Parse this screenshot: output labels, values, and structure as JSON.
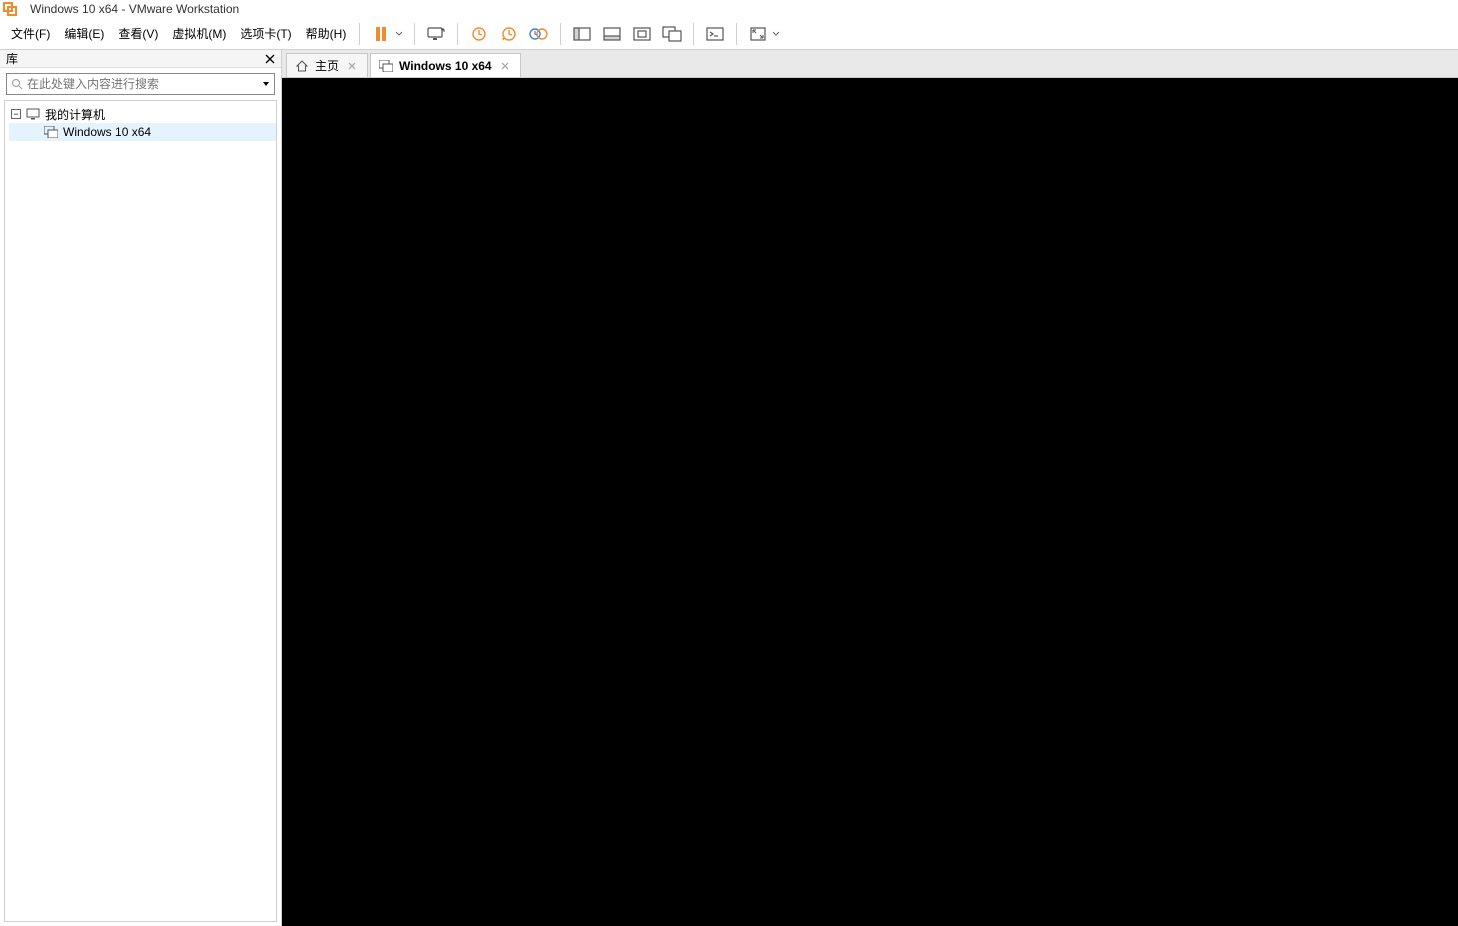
{
  "window": {
    "title": "Windows 10 x64 - VMware Workstation"
  },
  "menu": {
    "file": "文件(F)",
    "edit": "编辑(E)",
    "view": "查看(V)",
    "vm": "虚拟机(M)",
    "tabs": "选项卡(T)",
    "help": "帮助(H)"
  },
  "sidebar": {
    "title": "库",
    "search_placeholder": "在此处键入内容进行搜索",
    "tree": {
      "root_label": "我的计算机",
      "child_label": "Windows 10 x64"
    }
  },
  "tabs": {
    "home": "主页",
    "vm": "Windows 10 x64"
  },
  "colors": {
    "accent_orange": "#f28c2b",
    "icon_blue": "#3b82d6"
  }
}
